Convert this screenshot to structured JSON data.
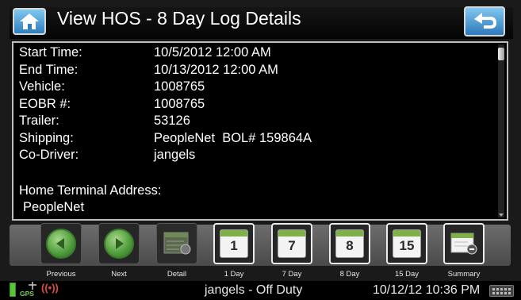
{
  "header": {
    "title": "View HOS - 8 Day Log Details"
  },
  "details": {
    "rows": [
      {
        "label": "Start Time:",
        "value": "10/5/2012 12:00 AM"
      },
      {
        "label": "End Time:",
        "value": "10/13/2012 12:00 AM"
      },
      {
        "label": "Vehicle:",
        "value": "1008765"
      },
      {
        "label": "EOBR #:",
        "value": "1008765"
      },
      {
        "label": "Trailer:",
        "value": "53126"
      },
      {
        "label": "Shipping:",
        "value": "PeopleNet  BOL# 159864A"
      },
      {
        "label": "Co-Driver:",
        "value": "jangels"
      }
    ],
    "home_terminal_label": "Home Terminal Address:",
    "home_terminal_value": "PeopleNet"
  },
  "toolbar": {
    "buttons": [
      {
        "label": "Previous",
        "icon": "left-arrow-icon"
      },
      {
        "label": "Next",
        "icon": "right-arrow-icon"
      },
      {
        "label": "Detail",
        "icon": "detail-icon"
      },
      {
        "label": "1 Day",
        "icon": "calendar-icon",
        "num": "1"
      },
      {
        "label": "7 Day",
        "icon": "calendar-icon",
        "num": "7"
      },
      {
        "label": "8 Day",
        "icon": "calendar-icon",
        "num": "8"
      },
      {
        "label": "15 Day",
        "icon": "calendar-icon",
        "num": "15"
      },
      {
        "label": "Summary",
        "icon": "summary-icon"
      }
    ]
  },
  "status_bar": {
    "gps_label": "GPS",
    "driver_status": "jangels - Off Duty",
    "datetime": "10/12/12 10:36 PM"
  },
  "colors": {
    "accent_blue": "#2f7fbf",
    "green": "#4c9a3a",
    "calendar_green": "#7fb04a"
  }
}
